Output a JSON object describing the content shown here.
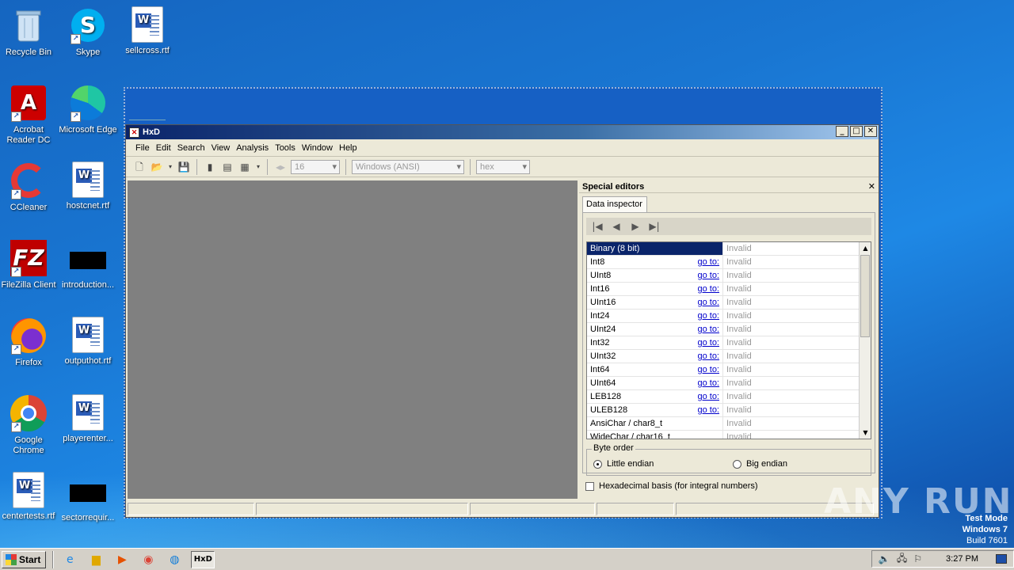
{
  "desktop": {
    "icons": [
      {
        "label": "Recycle Bin"
      },
      {
        "label": "Skype"
      },
      {
        "label": "sellcross.rtf"
      },
      {
        "label": "Acrobat Reader DC"
      },
      {
        "label": "Microsoft Edge"
      },
      {
        "label": "CCleaner"
      },
      {
        "label": "hostcnet.rtf"
      },
      {
        "label": "FileZilla Client"
      },
      {
        "label": "introduction..."
      },
      {
        "label": "Firefox"
      },
      {
        "label": "outputhot.rtf"
      },
      {
        "label": "Google Chrome"
      },
      {
        "label": "playerenter..."
      },
      {
        "label": "centertests.rtf"
      },
      {
        "label": "sectorrequir..."
      }
    ]
  },
  "window": {
    "title": "HxD",
    "icon_glyph": "✕"
  },
  "menu": [
    "File",
    "Edit",
    "Search",
    "View",
    "Analysis",
    "Tools",
    "Window",
    "Help"
  ],
  "toolbar": {
    "bytes_per_row": "16",
    "charset": "Windows (ANSI)",
    "offset_base": "hex"
  },
  "panel": {
    "title": "Special editors",
    "tab": "Data inspector",
    "goto_label": "go to:",
    "rows": [
      {
        "name": "Binary (8 bit)",
        "goto": false,
        "value": "Invalid",
        "selected": true
      },
      {
        "name": "Int8",
        "goto": true,
        "value": "Invalid"
      },
      {
        "name": "UInt8",
        "goto": true,
        "value": "Invalid"
      },
      {
        "name": "Int16",
        "goto": true,
        "value": "Invalid"
      },
      {
        "name": "UInt16",
        "goto": true,
        "value": "Invalid"
      },
      {
        "name": "Int24",
        "goto": true,
        "value": "Invalid"
      },
      {
        "name": "UInt24",
        "goto": true,
        "value": "Invalid"
      },
      {
        "name": "Int32",
        "goto": true,
        "value": "Invalid"
      },
      {
        "name": "UInt32",
        "goto": true,
        "value": "Invalid"
      },
      {
        "name": "Int64",
        "goto": true,
        "value": "Invalid"
      },
      {
        "name": "UInt64",
        "goto": true,
        "value": "Invalid"
      },
      {
        "name": "LEB128",
        "goto": true,
        "value": "Invalid"
      },
      {
        "name": "ULEB128",
        "goto": true,
        "value": "Invalid"
      },
      {
        "name": "AnsiChar / char8_t",
        "goto": false,
        "value": "Invalid"
      },
      {
        "name": "WideChar / char16_t",
        "goto": false,
        "value": "Invalid"
      }
    ],
    "byte_order": {
      "legend": "Byte order",
      "little": "Little endian",
      "big": "Big endian",
      "selected": "little"
    },
    "hex_basis": "Hexadecimal basis (for integral numbers)"
  },
  "watermark": "ANY RUN",
  "testmode": {
    "line1": "Test Mode",
    "line2": "Windows 7",
    "line3": "Build 7601"
  },
  "taskbar": {
    "start": "Start",
    "active_app": "HxD",
    "clock": "3:27 PM"
  }
}
